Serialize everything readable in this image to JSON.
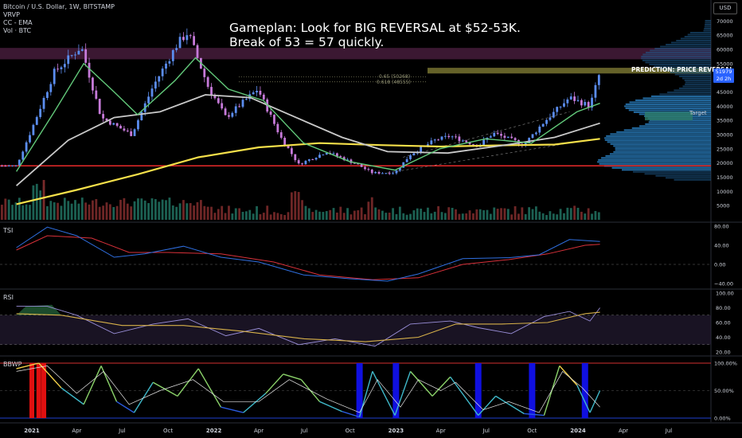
{
  "legend": {
    "symbol": "Bitcoin / U.S. Dollar, 1W, BITSTAMP",
    "ind1": "VRVP",
    "ind2": "CC - EMA",
    "ind3": "Vol · BTC"
  },
  "annotation": {
    "line1": "Gameplan: Look for BIG REVERSAL at $52-53K.",
    "line2": "Break of 53 = 57 quickly.",
    "prediction": "PREDICTION: PRICE REVERSAL",
    "target": "Target",
    "fib1": "0.65 (50268)",
    "fib2": "0.618 (48555)"
  },
  "price_tag": {
    "price": "51979",
    "time": "2d 2h"
  },
  "panes": {
    "tsi": "TSI",
    "rsi": "RSI",
    "bbwp": "BBWP"
  },
  "currency": "USD",
  "colors": {
    "up": "#5b8def",
    "down": "#c67ad9",
    "ema_fast": "#62c97a",
    "ema_mid": "#c9c9c9",
    "ema_slow": "#f5e04a",
    "hline": "#ff2e2e",
    "zone": "#b84c9a",
    "pred_zone": "#b8b24a",
    "vp": "#2f8fd8"
  },
  "chart_data": [
    {
      "type": "candlestick",
      "title": "Bitcoin / U.S. Dollar, 1W, BITSTAMP",
      "y_ticks": [
        5000,
        10000,
        15000,
        20000,
        25000,
        30000,
        35000,
        40000,
        45000,
        50000,
        55000,
        60000,
        65000,
        70000
      ],
      "ylim": [
        0,
        74000
      ],
      "x_ticks": [
        "2021",
        "Apr",
        "Jul",
        "Oct",
        "2022",
        "Apr",
        "Jul",
        "Oct",
        "2023",
        "Apr",
        "Jul",
        "Oct",
        "2024",
        "Apr",
        "Jul"
      ],
      "close_path": [
        [
          "2020-12-01",
          19000
        ],
        [
          "2021-01-01",
          32000
        ],
        [
          "2021-02-15",
          52000
        ],
        [
          "2021-04-10",
          61000
        ],
        [
          "2021-05-20",
          36000
        ],
        [
          "2021-07-20",
          30000
        ],
        [
          "2021-09-01",
          47000
        ],
        [
          "2021-10-20",
          62000
        ],
        [
          "2021-11-10",
          66000
        ],
        [
          "2021-12-20",
          47000
        ],
        [
          "2022-01-25",
          36000
        ],
        [
          "2022-03-30",
          46000
        ],
        [
          "2022-05-15",
          29000
        ],
        [
          "2022-06-20",
          19500
        ],
        [
          "2022-08-15",
          24000
        ],
        [
          "2022-10-15",
          19500
        ],
        [
          "2022-11-15",
          16500
        ],
        [
          "2022-12-30",
          16600
        ],
        [
          "2023-01-30",
          23000
        ],
        [
          "2023-03-20",
          28000
        ],
        [
          "2023-04-20",
          29500
        ],
        [
          "2023-06-15",
          26000
        ],
        [
          "2023-07-15",
          30500
        ],
        [
          "2023-09-15",
          26500
        ],
        [
          "2023-10-25",
          34500
        ],
        [
          "2023-12-15",
          43000
        ],
        [
          "2024-01-25",
          40000
        ],
        [
          "2024-02-14",
          51979
        ]
      ],
      "ema_fast": [
        [
          "2020-12-01",
          17000
        ],
        [
          "2021-02-15",
          38000
        ],
        [
          "2021-04-15",
          55000
        ],
        [
          "2021-06-15",
          45000
        ],
        [
          "2021-08-01",
          37000
        ],
        [
          "2021-10-15",
          49000
        ],
        [
          "2021-11-25",
          57000
        ],
        [
          "2022-01-30",
          46000
        ],
        [
          "2022-04-10",
          42000
        ],
        [
          "2022-06-30",
          27000
        ],
        [
          "2022-09-30",
          20500
        ],
        [
          "2022-12-30",
          17500
        ],
        [
          "2023-03-30",
          25000
        ],
        [
          "2023-06-30",
          28500
        ],
        [
          "2023-09-30",
          27000
        ],
        [
          "2023-12-30",
          38000
        ],
        [
          "2024-02-14",
          41000
        ]
      ],
      "ema_mid": [
        [
          "2020-12-01",
          12000
        ],
        [
          "2021-03-15",
          28000
        ],
        [
          "2021-06-15",
          36000
        ],
        [
          "2021-09-15",
          38000
        ],
        [
          "2021-12-15",
          44000
        ],
        [
          "2022-03-15",
          43000
        ],
        [
          "2022-06-15",
          36000
        ],
        [
          "2022-09-15",
          29000
        ],
        [
          "2022-12-15",
          24000
        ],
        [
          "2023-04-15",
          23500
        ],
        [
          "2023-08-15",
          26500
        ],
        [
          "2023-11-15",
          29000
        ],
        [
          "2024-02-14",
          34000
        ]
      ],
      "ema_slow": [
        [
          "2020-12-01",
          5500
        ],
        [
          "2021-04-01",
          10500
        ],
        [
          "2021-08-01",
          16000
        ],
        [
          "2021-12-01",
          22000
        ],
        [
          "2022-04-01",
          25500
        ],
        [
          "2022-08-01",
          27000
        ],
        [
          "2022-12-01",
          26300
        ],
        [
          "2023-04-01",
          25800
        ],
        [
          "2023-08-01",
          26200
        ],
        [
          "2023-11-15",
          26500
        ],
        [
          "2024-02-14",
          28500
        ]
      ],
      "hlines": [
        19000
      ],
      "zones": [
        [
          56500,
          60500
        ],
        [
          51500,
          53500
        ]
      ]
    },
    {
      "type": "line",
      "title": "TSI",
      "y_ticks": [
        -40,
        0,
        40,
        80
      ],
      "ylim": [
        -40,
        80
      ],
      "series": [
        {
          "values": [
            [
              "2020-12-01",
              35
            ],
            [
              "2021-02-01",
              78
            ],
            [
              "2021-04-01",
              60
            ],
            [
              "2021-06-15",
              15
            ],
            [
              "2021-08-15",
              22
            ],
            [
              "2021-11-01",
              38
            ],
            [
              "2022-01-15",
              15
            ],
            [
              "2022-04-01",
              5
            ],
            [
              "2022-06-30",
              -22
            ],
            [
              "2022-09-30",
              -30
            ],
            [
              "2022-12-15",
              -35
            ],
            [
              "2023-02-15",
              -20
            ],
            [
              "2023-05-15",
              12
            ],
            [
              "2023-08-15",
              14
            ],
            [
              "2023-10-15",
              20
            ],
            [
              "2023-12-15",
              52
            ],
            [
              "2024-02-14",
              48
            ]
          ]
        },
        {
          "values": [
            [
              "2020-12-01",
              30
            ],
            [
              "2021-02-01",
              60
            ],
            [
              "2021-05-01",
              55
            ],
            [
              "2021-07-15",
              25
            ],
            [
              "2021-10-01",
              25
            ],
            [
              "2022-01-15",
              22
            ],
            [
              "2022-05-01",
              5
            ],
            [
              "2022-08-01",
              -22
            ],
            [
              "2022-11-15",
              -32
            ],
            [
              "2023-02-15",
              -28
            ],
            [
              "2023-05-15",
              0
            ],
            [
              "2023-08-15",
              10
            ],
            [
              "2023-11-01",
              22
            ],
            [
              "2024-01-15",
              40
            ],
            [
              "2024-02-14",
              42
            ]
          ]
        }
      ]
    },
    {
      "type": "line",
      "title": "RSI",
      "y_ticks": [
        20,
        40,
        60,
        80,
        100
      ],
      "ylim": [
        20,
        100
      ],
      "series": [
        {
          "values": [
            [
              "2020-12-01",
              82
            ],
            [
              "2021-02-01",
              82
            ],
            [
              "2021-04-01",
              70
            ],
            [
              "2021-06-15",
              45
            ],
            [
              "2021-09-01",
              58
            ],
            [
              "2021-11-10",
              65
            ],
            [
              "2022-01-25",
              42
            ],
            [
              "2022-04-01",
              52
            ],
            [
              "2022-06-20",
              30
            ],
            [
              "2022-09-01",
              38
            ],
            [
              "2022-11-20",
              28
            ],
            [
              "2023-01-30",
              58
            ],
            [
              "2023-04-20",
              62
            ],
            [
              "2023-06-15",
              53
            ],
            [
              "2023-08-20",
              45
            ],
            [
              "2023-10-25",
              68
            ],
            [
              "2023-12-15",
              75
            ],
            [
              "2024-01-25",
              62
            ],
            [
              "2024-02-14",
              80
            ]
          ]
        },
        {
          "values": [
            [
              "2020-12-01",
              72
            ],
            [
              "2021-03-01",
              70
            ],
            [
              "2021-07-01",
              56
            ],
            [
              "2021-11-01",
              56
            ],
            [
              "2022-03-01",
              48
            ],
            [
              "2022-07-01",
              38
            ],
            [
              "2022-11-01",
              34
            ],
            [
              "2023-02-15",
              40
            ],
            [
              "2023-05-01",
              58
            ],
            [
              "2023-08-01",
              58
            ],
            [
              "2023-11-01",
              60
            ],
            [
              "2024-01-15",
              72
            ],
            [
              "2024-02-14",
              74
            ]
          ]
        }
      ]
    },
    {
      "type": "line",
      "title": "BBWP",
      "y_ticks": [
        "0.00%",
        "50.00%",
        "100.00%"
      ],
      "ylim": [
        0,
        100
      ],
      "spikes_low": [
        "2021-01-01",
        "2021-01-15",
        "2021-01-25"
      ],
      "spikes_high": [
        "2022-10-20",
        "2023-01-01",
        "2023-06-15",
        "2023-10-01",
        "2024-01-15"
      ],
      "series": [
        {
          "values": [
            [
              "2020-12-01",
              90
            ],
            [
              "2021-01-15",
              100
            ],
            [
              "2021-03-01",
              55
            ],
            [
              "2021-04-15",
              25
            ],
            [
              "2021-05-20",
              95
            ],
            [
              "2021-06-20",
              30
            ],
            [
              "2021-07-25",
              10
            ],
            [
              "2021-09-01",
              65
            ],
            [
              "2021-10-20",
              40
            ],
            [
              "2021-12-01",
              90
            ],
            [
              "2022-01-15",
              20
            ],
            [
              "2022-03-01",
              10
            ],
            [
              "2022-04-15",
              45
            ],
            [
              "2022-05-20",
              80
            ],
            [
              "2022-06-25",
              70
            ],
            [
              "2022-08-01",
              30
            ],
            [
              "2022-09-15",
              12
            ],
            [
              "2022-10-20",
              2
            ],
            [
              "2022-11-15",
              85
            ],
            [
              "2022-12-30",
              5
            ],
            [
              "2023-01-30",
              85
            ],
            [
              "2023-03-15",
              40
            ],
            [
              "2023-04-20",
              75
            ],
            [
              "2023-06-15",
              5
            ],
            [
              "2023-07-20",
              40
            ],
            [
              "2023-09-15",
              8
            ],
            [
              "2023-10-25",
              5
            ],
            [
              "2023-11-25",
              95
            ],
            [
              "2023-12-30",
              60
            ],
            [
              "2024-01-25",
              10
            ],
            [
              "2024-02-14",
              50
            ]
          ]
        },
        {
          "values": [
            [
              "2020-12-01",
              85
            ],
            [
              "2021-02-01",
              95
            ],
            [
              "2021-04-01",
              45
            ],
            [
              "2021-05-25",
              85
            ],
            [
              "2021-07-15",
              25
            ],
            [
              "2021-09-15",
              50
            ],
            [
              "2021-11-20",
              70
            ],
            [
              "2022-01-20",
              30
            ],
            [
              "2022-04-01",
              30
            ],
            [
              "2022-06-01",
              70
            ],
            [
              "2022-08-15",
              35
            ],
            [
              "2022-10-20",
              10
            ],
            [
              "2022-11-25",
              70
            ],
            [
              "2023-01-10",
              20
            ],
            [
              "2023-02-15",
              70
            ],
            [
              "2023-04-01",
              50
            ],
            [
              "2023-05-01",
              65
            ],
            [
              "2023-06-25",
              15
            ],
            [
              "2023-08-15",
              30
            ],
            [
              "2023-10-15",
              10
            ],
            [
              "2023-12-01",
              85
            ],
            [
              "2024-01-10",
              55
            ],
            [
              "2024-02-14",
              20
            ]
          ]
        }
      ]
    }
  ]
}
